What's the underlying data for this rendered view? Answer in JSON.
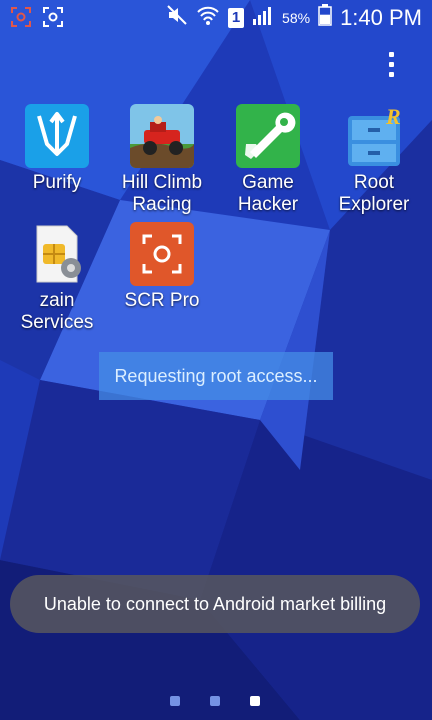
{
  "status_bar": {
    "sim_slot": "1",
    "battery_percent": "58%",
    "battery_level": 0.58,
    "time": "1:40 PM",
    "icons": [
      "screen-record-icon",
      "screenshot-icon",
      "mute-icon",
      "wifi-icon",
      "sim-icon",
      "signal-icon",
      "battery-icon"
    ]
  },
  "apps": [
    {
      "label": "Purify",
      "icon": "trident-icon",
      "color": "#1aa0e8"
    },
    {
      "label": "Hill Climb\nRacing",
      "icon": "jeep-icon",
      "color": "#4a9a3a"
    },
    {
      "label": "Game\nHacker",
      "icon": "wrench-icon",
      "color": "#32b34a"
    },
    {
      "label": "Root\nExplorer",
      "icon": "cabinet-icon",
      "color": "#3a8fe0"
    },
    {
      "label": "zain\nServices",
      "icon": "sim-card-icon",
      "color": "#f0f0f0"
    },
    {
      "label": "SCR Pro",
      "icon": "screen-recorder-icon",
      "color": "#e0572a"
    }
  ],
  "progress_message": "Requesting root access...",
  "toast_message": "Unable to connect to Android market billing",
  "page_indicator": {
    "count": 3,
    "active": 3
  }
}
